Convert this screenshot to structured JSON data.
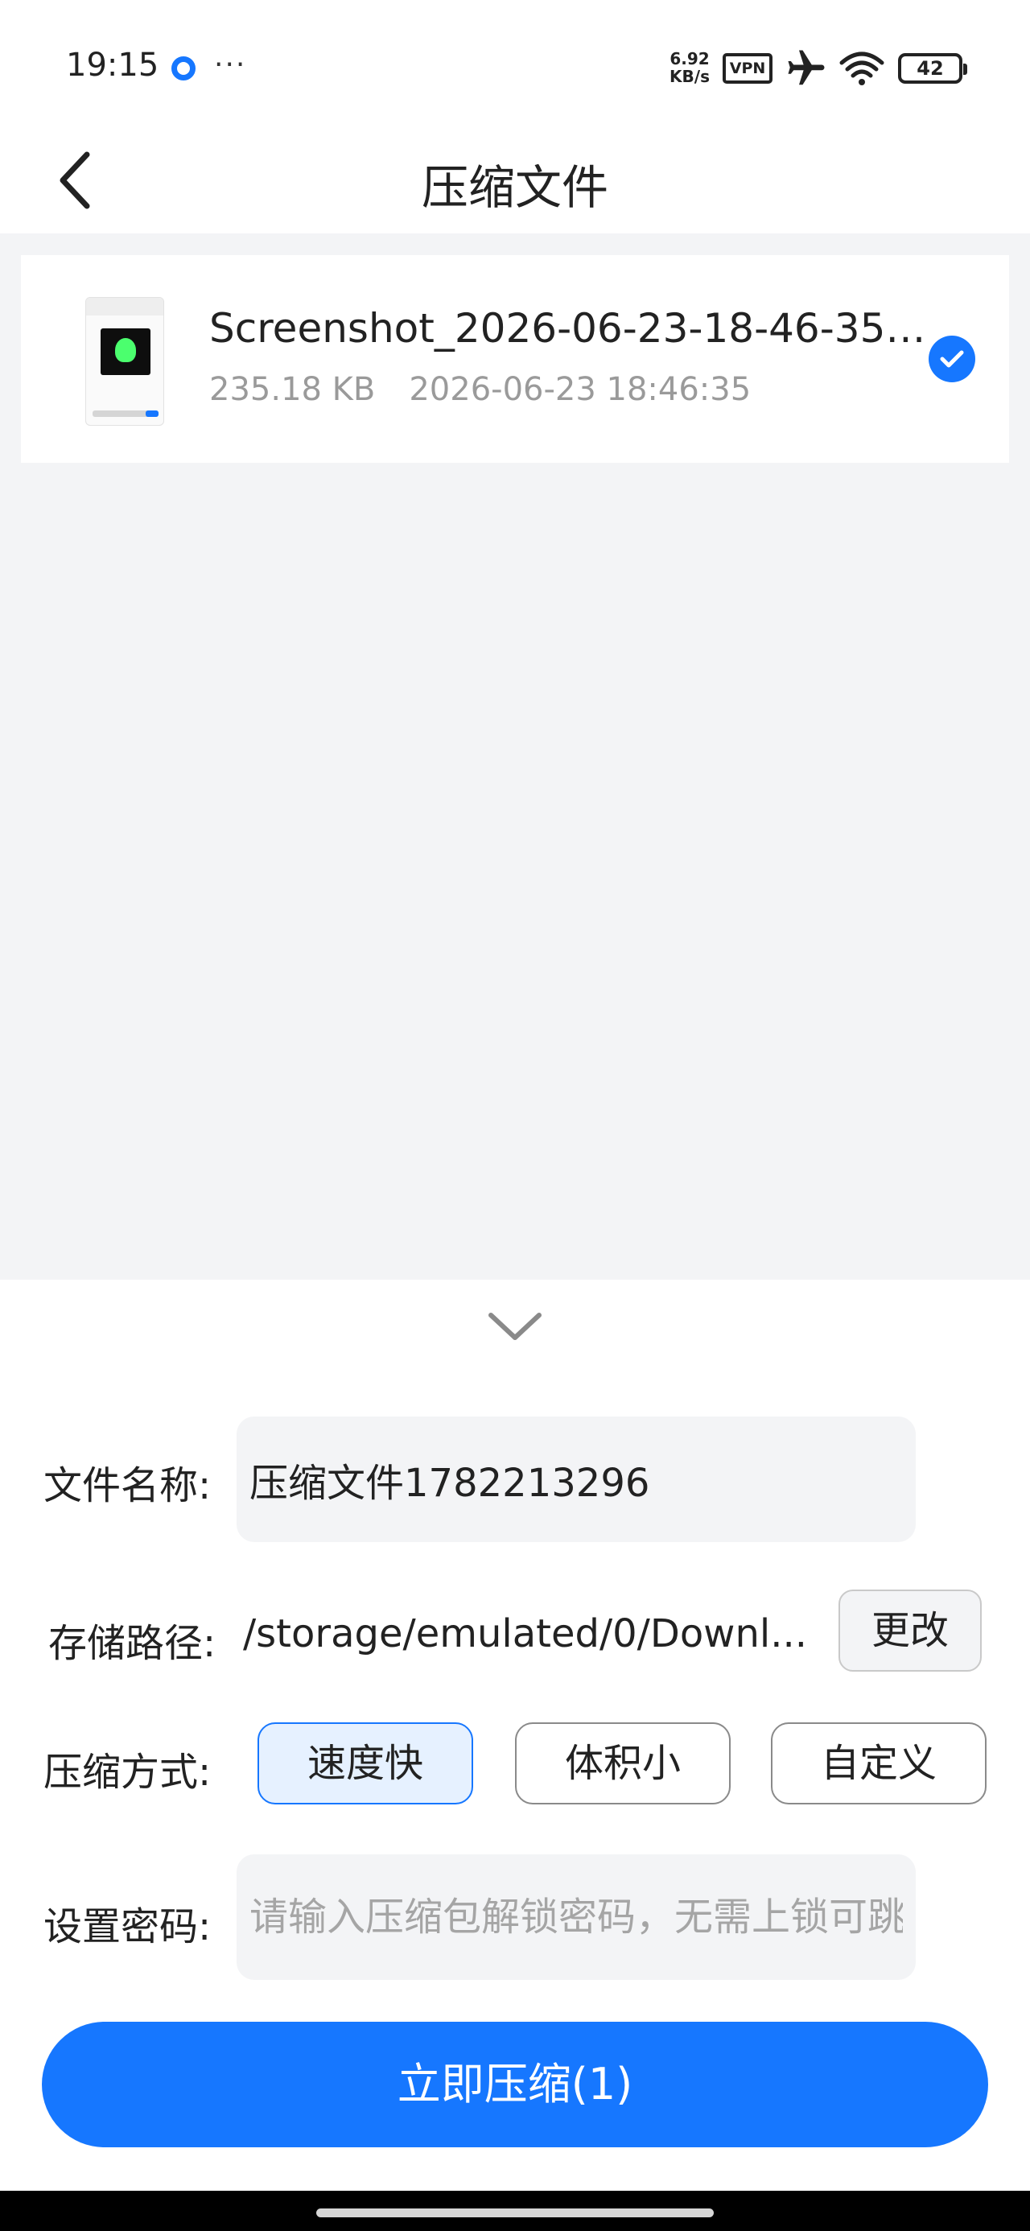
{
  "status_bar": {
    "time": "19:15",
    "speed_value": "6.92",
    "speed_unit": "KB/s",
    "vpn_label": "VPN",
    "battery_level": "42",
    "icons": [
      "record-dot-icon",
      "more-dots-icon",
      "airplane-icon",
      "wifi-icon",
      "battery-icon"
    ]
  },
  "header": {
    "title": "压缩文件",
    "back_icon": "chevron-left-icon"
  },
  "file": {
    "name": "Screenshot_2026-06-23-18-46-35-...",
    "size": "235.18 KB",
    "datetime": "2026-06-23 18:46:35",
    "selected": true
  },
  "form": {
    "filename_label": "文件名称:",
    "filename_value": "压缩文件1782213296",
    "path_label": "存储路径:",
    "path_value": "/storage/emulated/0/Downl...",
    "change_label": "更改",
    "mode_label": "压缩方式:",
    "modes": [
      "速度快",
      "体积小",
      "自定义"
    ],
    "active_mode": "速度快",
    "password_label": "设置密码:",
    "password_placeholder": "请输入压缩包解锁密码，无需上锁可跳过"
  },
  "submit_label": "立即压缩(1)",
  "colors": {
    "accent": "#1677ff",
    "page_background": "#f3f4f6",
    "active_mode_background": "#e6f1ff"
  }
}
